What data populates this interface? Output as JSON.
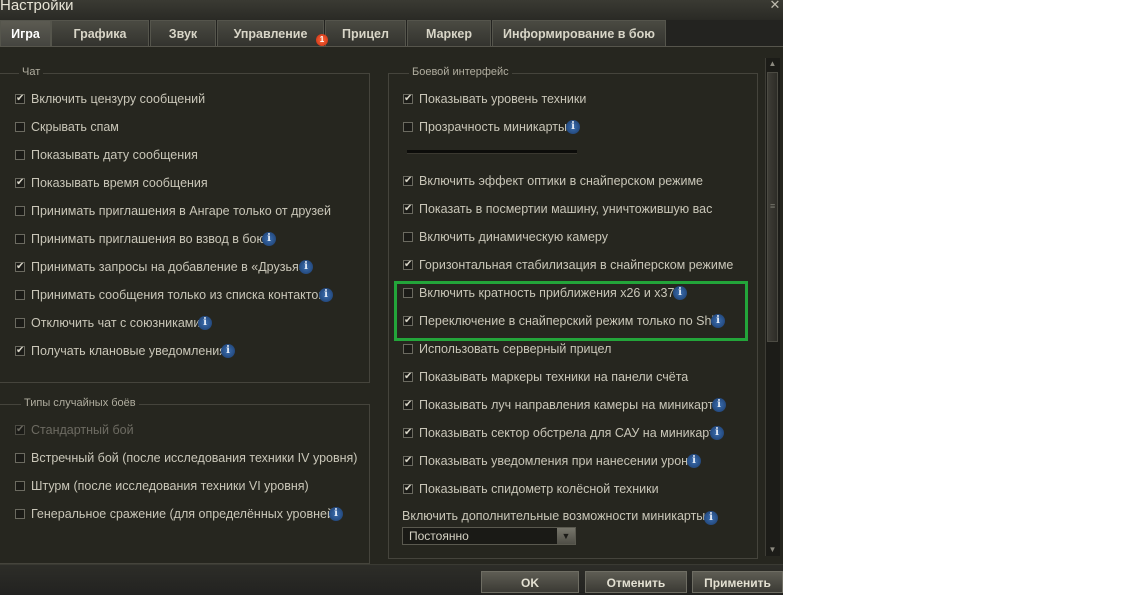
{
  "window": {
    "title": "Настройки",
    "close_glyph": "✕"
  },
  "tabs": [
    {
      "label": "Игра",
      "active": true
    },
    {
      "label": "Графика",
      "active": false
    },
    {
      "label": "Звук",
      "active": false
    },
    {
      "label": "Управление",
      "active": false,
      "badge": "1"
    },
    {
      "label": "Прицел",
      "active": false
    },
    {
      "label": "Маркер",
      "active": false
    },
    {
      "label": "Информирование в бою",
      "active": false
    }
  ],
  "chat": {
    "title": "Чат",
    "options": [
      {
        "label": "Включить цензуру сообщений",
        "checked": true
      },
      {
        "label": "Скрывать спам",
        "checked": false
      },
      {
        "label": "Показывать дату сообщения",
        "checked": false
      },
      {
        "label": "Показывать время сообщения",
        "checked": true
      },
      {
        "label": "Принимать приглашения в Ангаре только от друзей",
        "checked": false
      },
      {
        "label": "Принимать приглашения во взвод в бою",
        "checked": false,
        "info": true
      },
      {
        "label": "Принимать запросы на добавление в «Друзья»",
        "checked": true,
        "info": true
      },
      {
        "label": "Принимать сообщения только из списка контактов",
        "checked": false,
        "info": true
      },
      {
        "label": "Отключить чат с союзниками",
        "checked": false,
        "info": true
      },
      {
        "label": "Получать клановые уведомления",
        "checked": true,
        "info": true
      }
    ]
  },
  "battle_types": {
    "title": "Типы случайных боёв",
    "options": [
      {
        "label": "Стандартный бой",
        "checked": true,
        "disabled": true
      },
      {
        "label": "Встречный бой (после исследования техники IV уровня)",
        "checked": false
      },
      {
        "label": "Штурм (после исследования техники VI уровня)",
        "checked": false
      },
      {
        "label": "Генеральное сражение (для определённых уровней)",
        "checked": false,
        "info": true
      }
    ]
  },
  "battle_ui": {
    "title": "Боевой интерфейс",
    "options": [
      {
        "label": "Показывать уровень техники",
        "checked": true
      },
      {
        "label": "Прозрачность миникарты",
        "checked": false,
        "info": true
      },
      {
        "label": "Включить эффект оптики в снайперском режиме",
        "checked": true
      },
      {
        "label": "Показать в посмертии машину, уничтожившую вас",
        "checked": true
      },
      {
        "label": "Включить динамическую камеру",
        "checked": false
      },
      {
        "label": "Горизонтальная стабилизация в снайперском режиме",
        "checked": true
      },
      {
        "label": "Включить кратность приближения x26 и x37",
        "checked": false,
        "info": true
      },
      {
        "label": "Переключение в снайперский режим только по Shift",
        "checked": true,
        "info": true
      },
      {
        "label": "Использовать серверный прицел",
        "checked": false
      },
      {
        "label": "Показывать маркеры техники на панели счёта",
        "checked": true
      },
      {
        "label": "Показывать луч направления камеры на миникарте",
        "checked": true,
        "info": true
      },
      {
        "label": "Показывать сектор обстрела для САУ на миникарте",
        "checked": true,
        "info": true
      },
      {
        "label": "Показывать уведомления при нанесении урона",
        "checked": true,
        "info": true
      },
      {
        "label": "Показывать спидометр колёсной техники",
        "checked": true
      }
    ],
    "minimap_label": "Включить дополнительные возможности миникарты",
    "minimap_value": "Постоянно"
  },
  "footer": {
    "ok": "OK",
    "cancel": "Отменить",
    "apply": "Применить"
  },
  "colors": {
    "highlight": "#23a53a",
    "info_icon": "#2a5a9a",
    "badge": "#e0441c"
  }
}
